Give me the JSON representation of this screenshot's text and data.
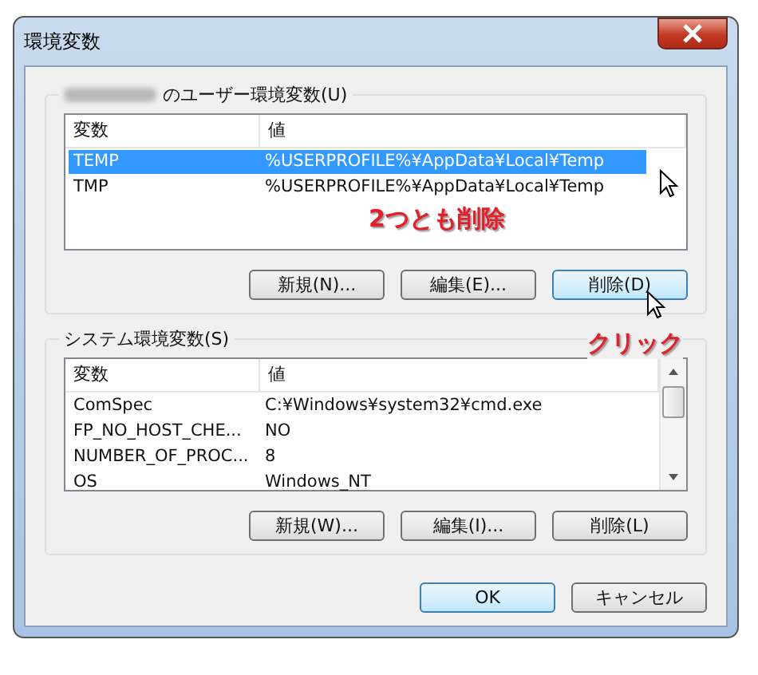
{
  "window": {
    "title": "環境変数"
  },
  "user_group": {
    "label": "のユーザー環境変数(U)",
    "columns": [
      "変数",
      "値"
    ],
    "rows": [
      {
        "cells": [
          "TEMP",
          "%USERPROFILE%¥AppData¥Local¥Temp"
        ],
        "selected": true
      },
      {
        "cells": [
          "TMP",
          "%USERPROFILE%¥AppData¥Local¥Temp"
        ],
        "selected": false
      }
    ],
    "note": "2つとも削除",
    "buttons": [
      {
        "label": "新規(N)...",
        "highlighted": false
      },
      {
        "label": "編集(E)...",
        "highlighted": false
      },
      {
        "label": "削除(D)",
        "highlighted": true
      }
    ]
  },
  "system_group": {
    "label": "システム環境変数(S)",
    "note": "クリック",
    "columns": [
      "変数",
      "値"
    ],
    "rows": [
      {
        "cells": [
          "ComSpec",
          "C:¥Windows¥system32¥cmd.exe"
        ],
        "selected": false
      },
      {
        "cells": [
          "FP_NO_HOST_CHE...",
          "NO"
        ],
        "selected": false
      },
      {
        "cells": [
          "NUMBER_OF_PROC...",
          "8"
        ],
        "selected": false
      },
      {
        "cells": [
          "OS",
          "Windows_NT"
        ],
        "selected": false
      }
    ],
    "buttons": [
      {
        "label": "新規(W)...",
        "highlighted": false
      },
      {
        "label": "編集(I)...",
        "highlighted": false
      },
      {
        "label": "削除(L)",
        "highlighted": false
      }
    ]
  },
  "buttons": [
    {
      "label": "OK",
      "highlighted": true
    },
    {
      "label": "キャンセル",
      "highlighted": false
    }
  ]
}
